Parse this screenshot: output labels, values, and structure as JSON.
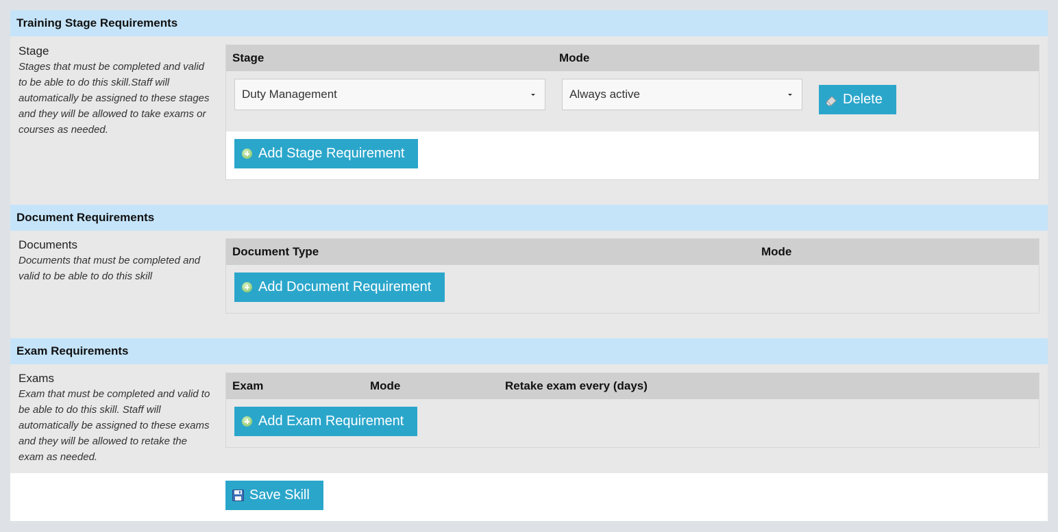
{
  "training": {
    "header": "Training Stage Requirements",
    "title": "Stage",
    "description": "Stages that must be completed and valid to be able to do this skill.Staff will automatically be assigned to these stages and they will be allowed to take exams or courses as needed.",
    "columns": [
      "Stage",
      "Mode"
    ],
    "row": {
      "stage_value": "Duty Management",
      "mode_value": "Always active",
      "delete_label": "Delete"
    },
    "add_label": "Add Stage Requirement"
  },
  "documents": {
    "header": "Document Requirements",
    "title": "Documents",
    "description": "Documents that must be completed and valid to be able to do this skill",
    "columns": [
      "Document Type",
      "Mode"
    ],
    "add_label": "Add Document Requirement"
  },
  "exams": {
    "header": "Exam Requirements",
    "title": "Exams",
    "description": "Exam that must be completed and valid to be able to do this skill. Staff will automatically be assigned to these exams and they will be allowed to retake the exam as needed.",
    "columns": [
      "Exam",
      "Mode",
      "Retake exam every (days)"
    ],
    "add_label": "Add Exam Requirement"
  },
  "footer": {
    "save_label": "Save Skill"
  },
  "icons": {
    "add": "add-circle-icon",
    "delete": "eraser-icon",
    "save": "floppy-disk-icon"
  },
  "colors": {
    "section_header": "#c5e4f9",
    "button": "#2ba6cb",
    "grid_header": "#cfcfcf",
    "panel": "#e8e8e8",
    "page": "#dee2e6"
  }
}
